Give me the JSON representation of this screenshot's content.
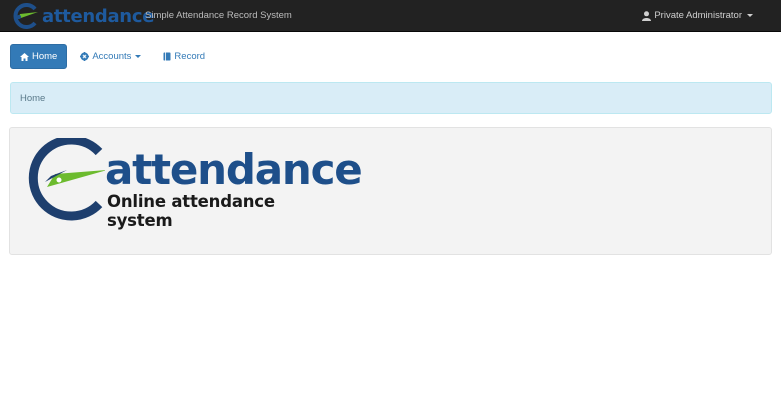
{
  "brand": {
    "name": "attendance",
    "tagline": "Simple Attendance Record System"
  },
  "user": {
    "name": "Private Administrator"
  },
  "nav": {
    "home_label": "Home",
    "accounts_label": "Accounts",
    "record_label": "Record"
  },
  "breadcrumb": {
    "current": "Home"
  },
  "logo": {
    "word": "attendance",
    "subtitle": "Online attendance system"
  },
  "colors": {
    "navbar_bg": "#222222",
    "primary": "#337ab7",
    "breadcrumb_bg": "#d9edf7",
    "panel_bg": "#f3f3f3",
    "logo_blue": "#1e4f8a",
    "logo_green": "#6cbb2e"
  }
}
